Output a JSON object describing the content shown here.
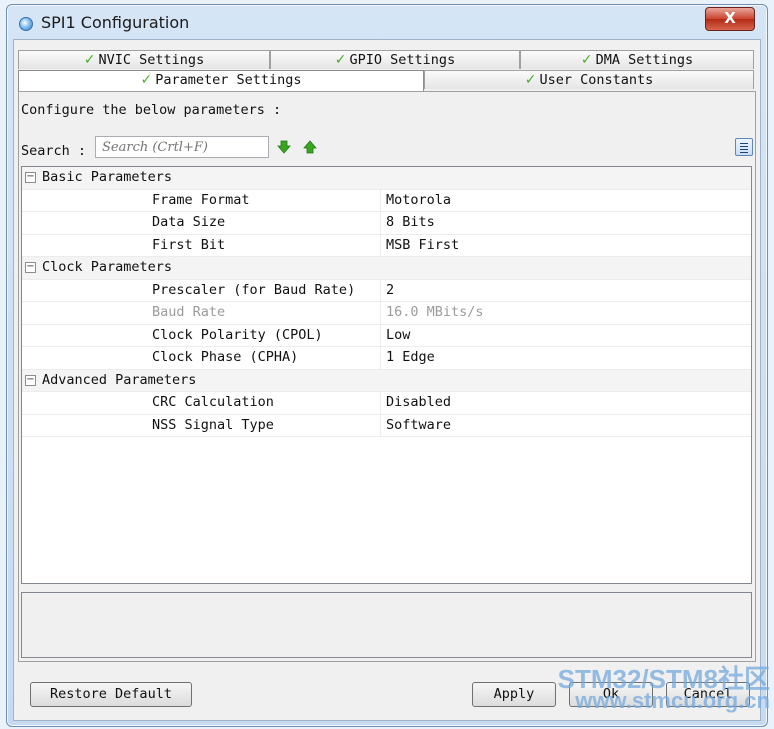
{
  "window": {
    "title": "SPI1 Configuration",
    "close_glyph": "X"
  },
  "tabs": {
    "back": [
      "NVIC Settings",
      "GPIO Settings",
      "DMA Settings"
    ],
    "front": [
      "Parameter Settings",
      "User Constants"
    ],
    "active": "Parameter Settings",
    "check_glyph": "✓"
  },
  "panel": {
    "description": "Configure the below parameters :",
    "search_label": "Search :",
    "search_placeholder": "Search (Crtl+F)"
  },
  "groups": [
    {
      "title": "Basic Parameters",
      "toggle": "−",
      "params": [
        {
          "name": "Frame Format",
          "value": "Motorola"
        },
        {
          "name": "Data Size",
          "value": "8 Bits"
        },
        {
          "name": "First Bit",
          "value": "MSB First"
        }
      ]
    },
    {
      "title": "Clock Parameters",
      "toggle": "−",
      "params": [
        {
          "name": "Prescaler (for Baud Rate)",
          "value": "2"
        },
        {
          "name": "Baud Rate",
          "value": "16.0 MBits/s"
        },
        {
          "name": "Clock Polarity (CPOL)",
          "value": "Low"
        },
        {
          "name": "Clock Phase (CPHA)",
          "value": "1 Edge"
        }
      ]
    },
    {
      "title": "Advanced Parameters",
      "toggle": "−",
      "params": [
        {
          "name": "CRC Calculation",
          "value": "Disabled"
        },
        {
          "name": "NSS Signal Type",
          "value": "Software"
        }
      ]
    }
  ],
  "buttons": {
    "restore": "Restore Default",
    "apply": "Apply",
    "ok": "Ok",
    "cancel": "Cancel"
  },
  "watermark": {
    "line1": "STM32/STM8社区",
    "line2": "www.stmcu.org.cn"
  },
  "colors": {
    "check": "#4caf2c",
    "arrow": "#3aa521",
    "close": "#c9432d",
    "disabled_text": "#9b9b9b"
  }
}
